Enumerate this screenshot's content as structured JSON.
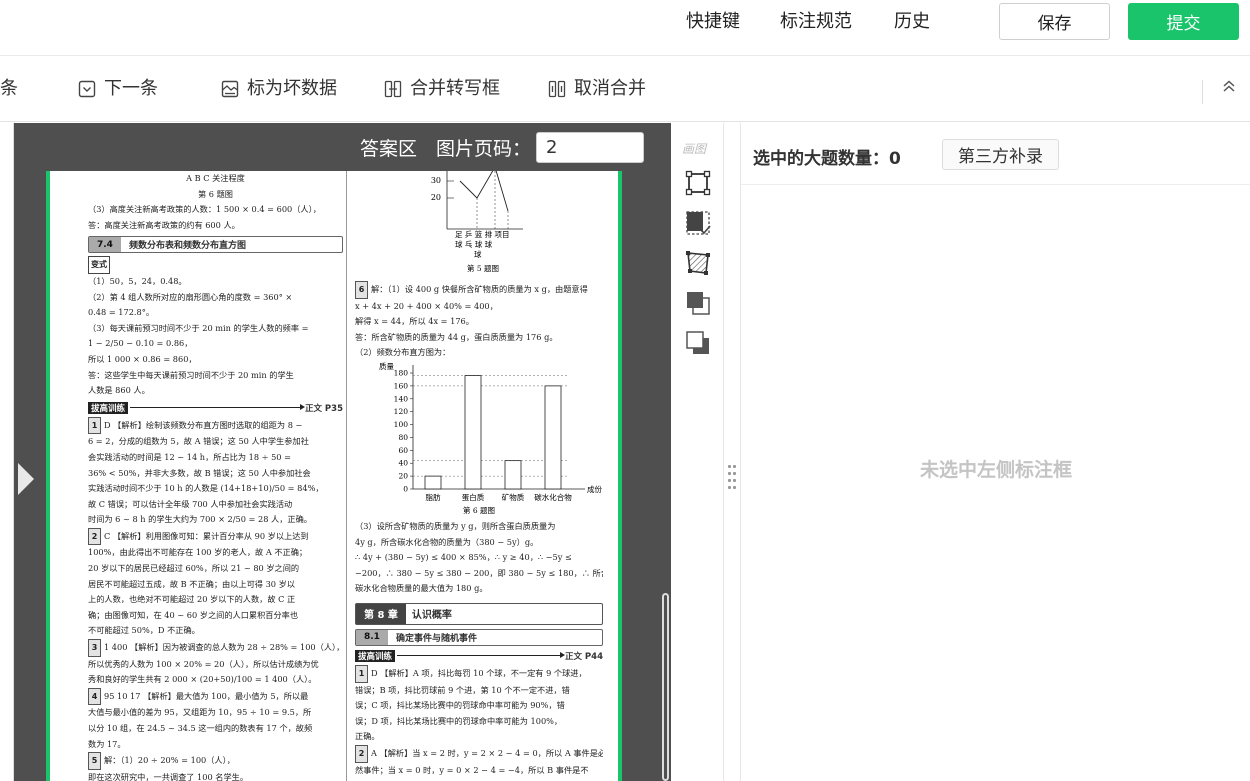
{
  "topbar": {
    "shortcuts": "快捷键",
    "guidelines": "标注规范",
    "history": "历史",
    "save": "保存",
    "submit": "提交",
    "accent_color": "#19c46b"
  },
  "toolbar": {
    "prev_partial": "条",
    "next": "下一条",
    "mark_bad": "标为坏数据",
    "merge": "合并转写框",
    "unmerge": "取消合并",
    "collapse_icon": "double-chevron-up-icon"
  },
  "viewer": {
    "answer_area": "答案区",
    "page_code_label": "图片页码：",
    "page_code_value": "2"
  },
  "toolstrip": {
    "draw_label": "画图",
    "tools": [
      "rectangle-tool-icon",
      "select-box-icon",
      "polygon-tool-icon",
      "bring-front-icon",
      "send-back-icon"
    ]
  },
  "right_panel": {
    "selected_count_label": "选中的大题数量：0",
    "third_party_button": "第三方补录",
    "empty_message": "未选中左侧标注框"
  },
  "document": {
    "left": [
      {
        "t": "cap",
        "text": "A          B          C        关注程度"
      },
      {
        "t": "cap",
        "text": "第 6 题图"
      },
      {
        "t": "ln",
        "text": "（3）高度关注新高考政策的人数：1 500 × 0.4 = 600（人），"
      },
      {
        "t": "ln",
        "text": "答：高度关注新高考政策的约有 600 人。"
      },
      {
        "t": "sec",
        "num": "7.4",
        "title": "频数分布表和频数分布直方图"
      },
      {
        "t": "tag",
        "text": "变式"
      },
      {
        "t": "ln",
        "text": "（1）50，5，24，0.48。"
      },
      {
        "t": "ln",
        "text": "（2）第 4 组人数所对应的扇形圆心角的度数 = 360° ×"
      },
      {
        "t": "ln",
        "text": "0.48 = 172.8°。"
      },
      {
        "t": "ln",
        "text": "（3）每天课前预习时间不少于 20 min 的学生人数的频率 ="
      },
      {
        "t": "ln",
        "text": "1 − 2/50 − 0.10 = 0.86，"
      },
      {
        "t": "ln",
        "text": "所以 1 000 × 0.86 = 860，"
      },
      {
        "t": "ln",
        "text": "答：这些学生中每天课前预习时间不少于 20 min 的学生"
      },
      {
        "t": "ln",
        "text": "人数是 860 人。"
      },
      {
        "t": "practice",
        "label": "拔高训练",
        "page": "正文 P35"
      },
      {
        "t": "q",
        "num": "1",
        "text": "D 【解析】绘制该频数分布直方图时选取的组距为 8 −"
      },
      {
        "t": "ln",
        "text": "6 = 2，分成的组数为 5，故 A 错误；这 50 人中学生参加社"
      },
      {
        "t": "ln",
        "text": "会实践活动的时间是 12 ~ 14 h，所占比为 18 ÷ 50 ="
      },
      {
        "t": "ln",
        "text": "36% < 50%，并非大多数，故 B 错误；这 50 人中参加社会"
      },
      {
        "t": "ln",
        "text": "实践活动时间不少于 10 h 的人数是 (14+18+10)/50 = 84%，"
      },
      {
        "t": "ln",
        "text": "故 C 错误；可以估计全年级 700 人中参加社会实践活动"
      },
      {
        "t": "ln",
        "text": "时间为 6 ~ 8 h 的学生大约为 700 × 2/50 = 28 人，正确。"
      },
      {
        "t": "q",
        "num": "2",
        "text": "C 【解析】利用图像可知：累计百分率从 90 岁以上达到"
      },
      {
        "t": "ln",
        "text": "100%，由此得出不可能存在 100 岁的老人，故 A 不正确；"
      },
      {
        "t": "ln",
        "text": "20 岁以下的居民已经超过 60%，所以 21 ~ 80 岁之间的"
      },
      {
        "t": "ln",
        "text": "居民不可能超过五成，故 B 不正确；由以上可得 30 岁以"
      },
      {
        "t": "ln",
        "text": "上的人数，也绝对不可能超过 20 岁以下的人数，故 C 正"
      },
      {
        "t": "ln",
        "text": "确；由图像可知，在 40 ~ 60 岁之间的人口累积百分率也"
      },
      {
        "t": "ln",
        "text": "不可能超过 50%，D 不正确。"
      },
      {
        "t": "q",
        "num": "3",
        "text": "1 400 【解析】因为被调查的总人数为 28 ÷ 28% = 100（人），"
      },
      {
        "t": "ln",
        "text": "所以优秀的人数为 100 × 20% = 20（人），所以估计成绩为优"
      },
      {
        "t": "ln",
        "text": "秀和良好的学生共有 2 000 × (20+50)/100 = 1 400（人）。"
      },
      {
        "t": "q",
        "num": "4",
        "text": "95   10   17  【解析】最大值为 100，最小值为 5，所以最"
      },
      {
        "t": "ln",
        "text": "大值与最小值的差为 95，又组距为 10，95 ÷ 10 = 9.5，所"
      },
      {
        "t": "ln",
        "text": "以分 10 组，在 24.5 ~ 34.5 这一组内的数表有 17 个，故频"
      },
      {
        "t": "ln",
        "text": "数为 17。"
      },
      {
        "t": "q",
        "num": "5",
        "text": "解：（1）20 ÷ 20% = 100（人），"
      },
      {
        "t": "ln",
        "text": "即在这次研究中，一共调查了 100 名学生。"
      }
    ],
    "right_top_captions": [
      "足  乒  篮  排  项目",
      "球  乓  球  球",
      "球",
      "第 5 题图"
    ],
    "right_mid": [
      {
        "t": "q",
        "num": "6",
        "text": "解：（1）设 400 g 快餐所含矿物质的质量为 x g，由题意得"
      },
      {
        "t": "ln",
        "text": "x + 4x + 20 + 400 × 40% = 400，"
      },
      {
        "t": "ln",
        "text": "解得 x = 44，所以 4x = 176。"
      },
      {
        "t": "ln",
        "text": "答：所含矿物质的质量为 44 g，蛋白质质量为 176 g。"
      },
      {
        "t": "ln",
        "text": "（2）频数分布直方图为："
      }
    ],
    "right_bottom": [
      {
        "t": "ln",
        "text": "（3）设所含矿物质的质量为 y g，则所含蛋白质质量为"
      },
      {
        "t": "ln",
        "text": "4y g，所含碳水化合物的质量为（380 − 5y）g。"
      },
      {
        "t": "ln",
        "text": "∴ 4y + (380 − 5y) ≤ 400 × 85%，∴ y ≥ 40，∴ −5y ≤"
      },
      {
        "t": "ln",
        "text": "−200，∴ 380 − 5y ≤ 380 − 200，即 380 − 5y ≤ 180，∴ 所含"
      },
      {
        "t": "ln",
        "text": "碳水化合物质量的最大值为 180 g。"
      },
      {
        "t": "chap",
        "num": "第 8 章",
        "title": "认识概率"
      },
      {
        "t": "sec",
        "num": "8.1",
        "title": "确定事件与随机事件"
      },
      {
        "t": "practice",
        "label": "拔高训练",
        "page": "正文 P44"
      },
      {
        "t": "q",
        "num": "1",
        "text": "D 【解析】A 项，抖比每罚 10 个球，不一定有 9 个球进，"
      },
      {
        "t": "ln",
        "text": "错误；B 项，抖比罚球前 9 个进，第 10 个不一定不进，错"
      },
      {
        "t": "ln",
        "text": "误；C 项，抖比某场比赛中的罚球命中率可能为 90%，错"
      },
      {
        "t": "ln",
        "text": "误；D 项，抖比某场比赛中的罚球命中率可能为 100%，"
      },
      {
        "t": "ln",
        "text": "正确。"
      },
      {
        "t": "q",
        "num": "2",
        "text": "A 【解析】当 x = 2 时，y = 2 × 2 − 4 = 0，所以 A 事件是必"
      },
      {
        "t": "ln",
        "text": "然事件；当 x = 0 时，y = 0 × 2 − 4 = −4，所以 B 事件是不"
      },
      {
        "t": "ln",
        "text": "可能事件；当 x > 0 时，y = 2x − 4 > −4，此时 y > 0 或 y <"
      },
      {
        "t": "ln",
        "text": "0，所以 C，D 都是随机事件。"
      }
    ]
  },
  "chart_data": [
    {
      "type": "line",
      "title": "第 5 题图",
      "ytick_labels": [
        "30",
        "20"
      ],
      "categories": [
        "足球",
        "乒乓球",
        "篮球",
        "排球"
      ],
      "xlabel": "项目"
    },
    {
      "type": "bar",
      "title": "第 6 题图",
      "ylabel": "质量",
      "xlabel": "成份",
      "categories": [
        "脂肪",
        "蛋白质",
        "矿物质",
        "碳水化合物"
      ],
      "values": [
        20,
        176,
        44,
        160
      ],
      "ylim": [
        0,
        180
      ],
      "yticks": [
        0,
        20,
        40,
        60,
        80,
        100,
        120,
        140,
        160,
        180
      ],
      "dashed_reference_lines": [
        176,
        160,
        44,
        20
      ]
    }
  ]
}
